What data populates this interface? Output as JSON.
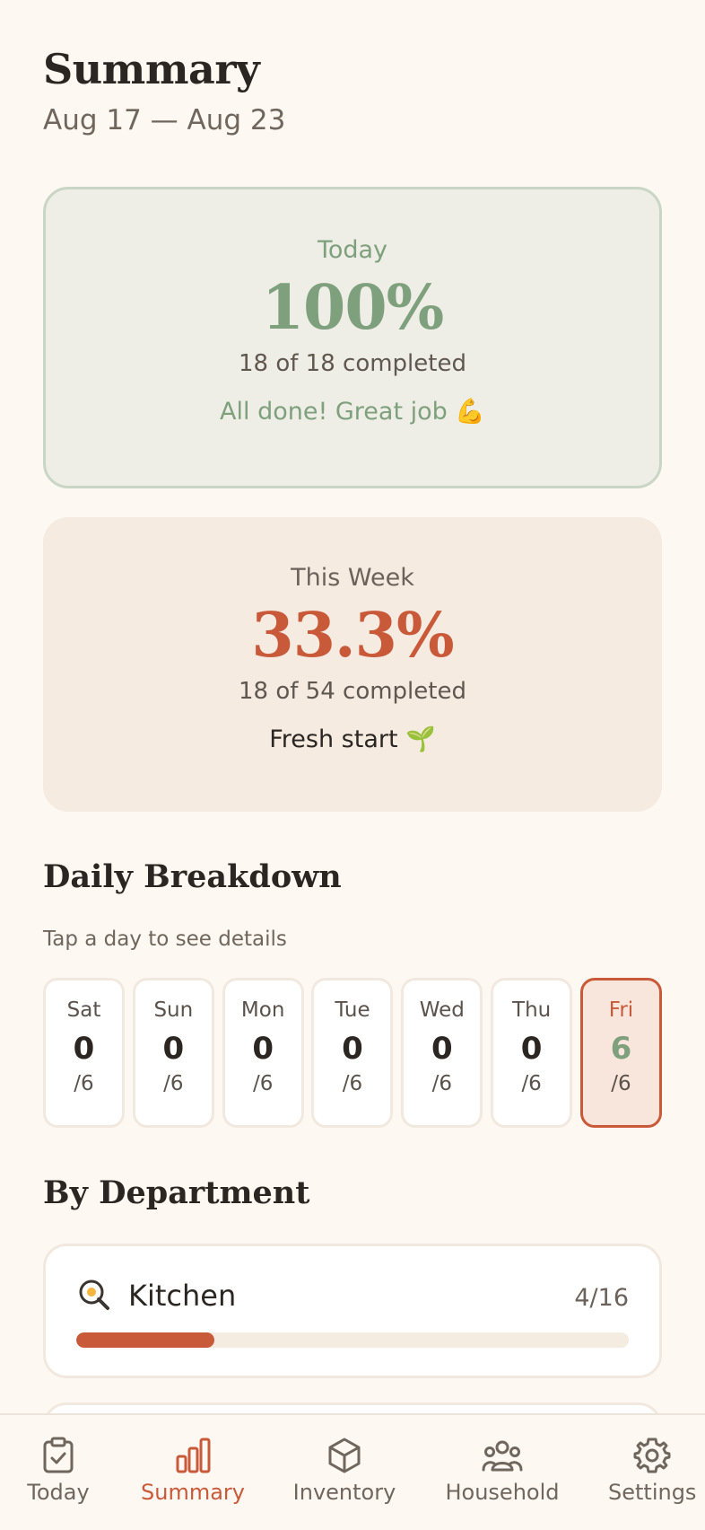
{
  "header": {
    "title": "Summary",
    "date_range": "Aug 17 — Aug 23"
  },
  "today_card": {
    "label": "Today",
    "percent": "100%",
    "count_text": "18 of 18 completed",
    "message": "All done! Great job 💪"
  },
  "week_card": {
    "label": "This Week",
    "percent": "33.3%",
    "count_text": "18 of 54 completed",
    "message": "Fresh start 🌱"
  },
  "daily_breakdown": {
    "title": "Daily Breakdown",
    "hint": "Tap a day to see details",
    "days": [
      {
        "name": "Sat",
        "count": "0",
        "total": "/6"
      },
      {
        "name": "Sun",
        "count": "0",
        "total": "/6"
      },
      {
        "name": "Mon",
        "count": "0",
        "total": "/6"
      },
      {
        "name": "Tue",
        "count": "0",
        "total": "/6"
      },
      {
        "name": "Wed",
        "count": "0",
        "total": "/6"
      },
      {
        "name": "Thu",
        "count": "0",
        "total": "/6"
      },
      {
        "name": "Fri",
        "count": "6",
        "total": "/6"
      }
    ],
    "selected_day": "Fri"
  },
  "by_department": {
    "title": "By Department",
    "departments": [
      {
        "icon": "frying-pan-icon",
        "name": "Kitchen",
        "count": "4/16",
        "progress": 0.25
      }
    ]
  },
  "tabbar": {
    "tabs": [
      {
        "label": "Today",
        "icon": "clipboard-check-icon"
      },
      {
        "label": "Summary",
        "icon": "bar-chart-icon"
      },
      {
        "label": "Inventory",
        "icon": "box-icon"
      },
      {
        "label": "Household",
        "icon": "people-icon"
      },
      {
        "label": "Settings",
        "icon": "gear-icon"
      }
    ],
    "active": "Summary"
  },
  "colors": {
    "background": "#fdf8f1",
    "accent_orange": "#c85a3a",
    "accent_green": "#7ea07d"
  }
}
